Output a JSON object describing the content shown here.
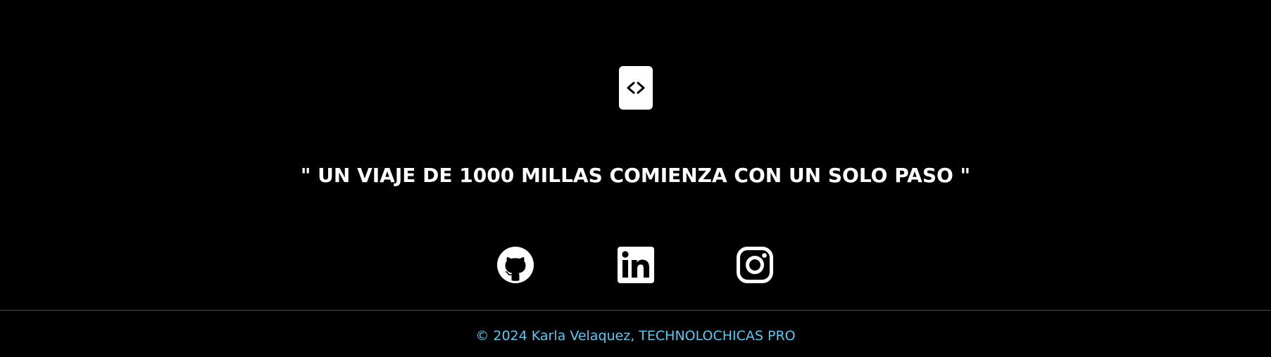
{
  "footer": {
    "logo_icon": "code-brackets-icon",
    "quote": "\" UN VIAJE DE 1000 MILLAS COMIENZA CON UN SOLO PASO \"",
    "social": [
      {
        "name": "github",
        "icon": "github-icon"
      },
      {
        "name": "linkedin",
        "icon": "linkedin-icon"
      },
      {
        "name": "instagram",
        "icon": "instagram-icon"
      }
    ],
    "copyright": "© 2024 Karla Velaquez, TECHNOLOCHICAS PRO",
    "colors": {
      "background": "#000000",
      "text": "#ffffff",
      "copyright": "#5ec8f2",
      "divider": "#4a4a4a"
    }
  }
}
